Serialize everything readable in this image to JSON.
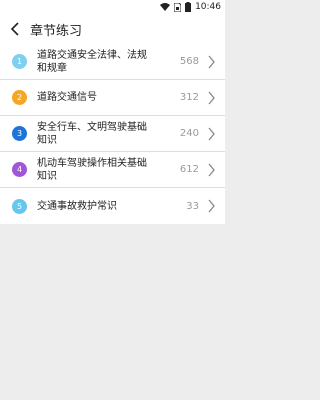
{
  "status_bar": {
    "time": "10:46"
  },
  "header": {
    "title": "章节练习"
  },
  "chapters": [
    {
      "number": "1",
      "title": "道路交通安全法律、法规和规章",
      "count": "568",
      "color": "#7dd0ee"
    },
    {
      "number": "2",
      "title": "道路交通信号",
      "count": "312",
      "color": "#f5a623"
    },
    {
      "number": "3",
      "title": "安全行车、文明驾驶基础知识",
      "count": "240",
      "color": "#1e74d8"
    },
    {
      "number": "4",
      "title": "机动车驾驶操作相关基础知识",
      "count": "612",
      "color": "#a056d6"
    },
    {
      "number": "5",
      "title": "交通事故救护常识",
      "count": "33",
      "color": "#66c7ee"
    }
  ]
}
